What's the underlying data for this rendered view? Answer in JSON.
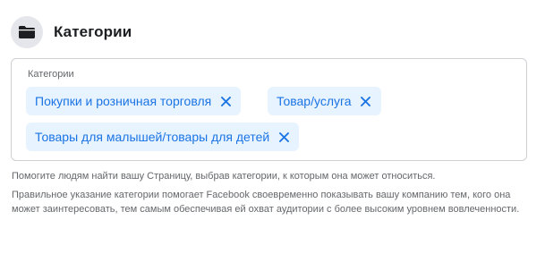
{
  "section": {
    "icon": "folder-icon",
    "title": "Категории"
  },
  "field": {
    "label": "Категории",
    "chips": [
      {
        "label": "Покупки и розничная торговля",
        "remove_icon": "close-icon"
      },
      {
        "label": "Товар/услуга",
        "remove_icon": "close-icon"
      },
      {
        "label": "Товары для малышей/товары для детей",
        "remove_icon": "close-icon"
      }
    ]
  },
  "help_text": "Помогите людям найти вашу Страницу, выбрав категории, к которым она может относиться.",
  "info_text": "Правильное указание категории помогает Facebook своевременно показывать вашу компанию тем, кого она может заинтересовать, тем самым обеспечивая ей охват аудитории с более высоким уровнем вовлеченности.",
  "colors": {
    "chip_background": "#e7f3ff",
    "chip_text": "#1b74e4",
    "title_text": "#1c1e21",
    "secondary_text": "#65676b",
    "border": "#ced0d4",
    "icon_circle": "#e4e6eb"
  }
}
